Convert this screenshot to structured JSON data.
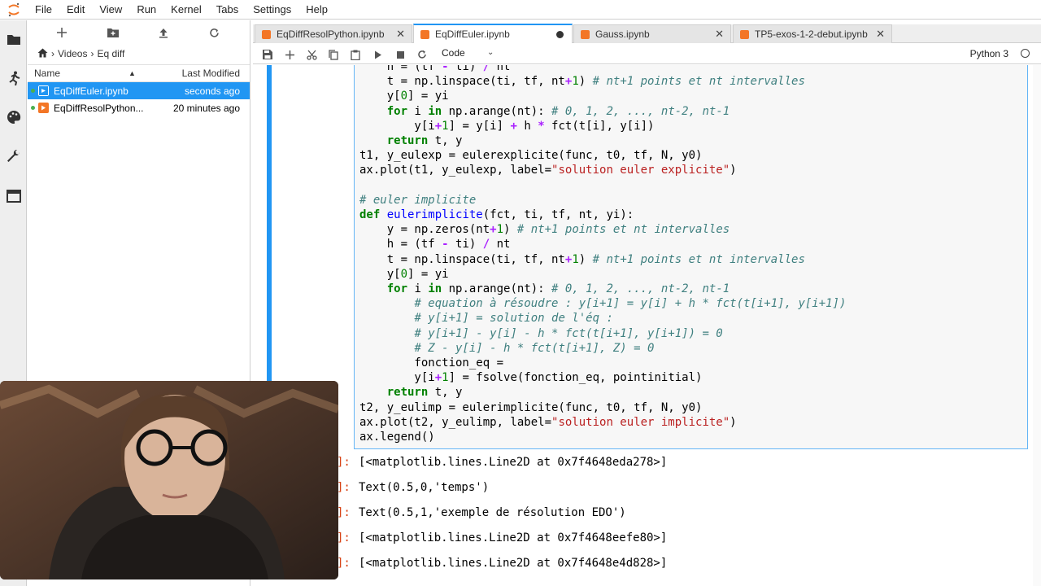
{
  "menu": [
    "File",
    "Edit",
    "View",
    "Run",
    "Kernel",
    "Tabs",
    "Settings",
    "Help"
  ],
  "breadcrumb": {
    "folder": "Videos",
    "current": "Eq diff"
  },
  "filebrowser": {
    "col_name": "Name",
    "col_modified": "Last Modified",
    "files": [
      {
        "name": "EqDiffEuler.ipynb",
        "modified": "seconds ago"
      },
      {
        "name": "EqDiffResolPython...",
        "modified": "20 minutes ago"
      }
    ]
  },
  "tabs": [
    {
      "label": "EqDiffResolPython.ipynb"
    },
    {
      "label": "EqDiffEuler.ipynb"
    },
    {
      "label": "Gauss.ipynb"
    },
    {
      "label": "TP5-exos-1-2-debut.ipynb"
    }
  ],
  "toolbar": {
    "cell_type": "Code",
    "kernel": "Python 3"
  },
  "outputs": [
    {
      "prompt": "]:",
      "text": "[<matplotlib.lines.Line2D at 0x7f4648eda278>]"
    },
    {
      "prompt": "]:",
      "text": "Text(0.5,0,'temps')"
    },
    {
      "prompt": "]:",
      "text": "Text(0.5,1,'exemple de résolution EDO')"
    },
    {
      "prompt": "]:",
      "text": "[<matplotlib.lines.Line2D at 0x7f4648eefe80>]"
    },
    {
      "prompt": "]:",
      "text": "[<matplotlib.lines.Line2D at 0x7f4648e4d828>]"
    }
  ],
  "colors": {
    "accent": "#2196f3",
    "notebook_icon": "#f37626",
    "prompt": "#d84315"
  }
}
